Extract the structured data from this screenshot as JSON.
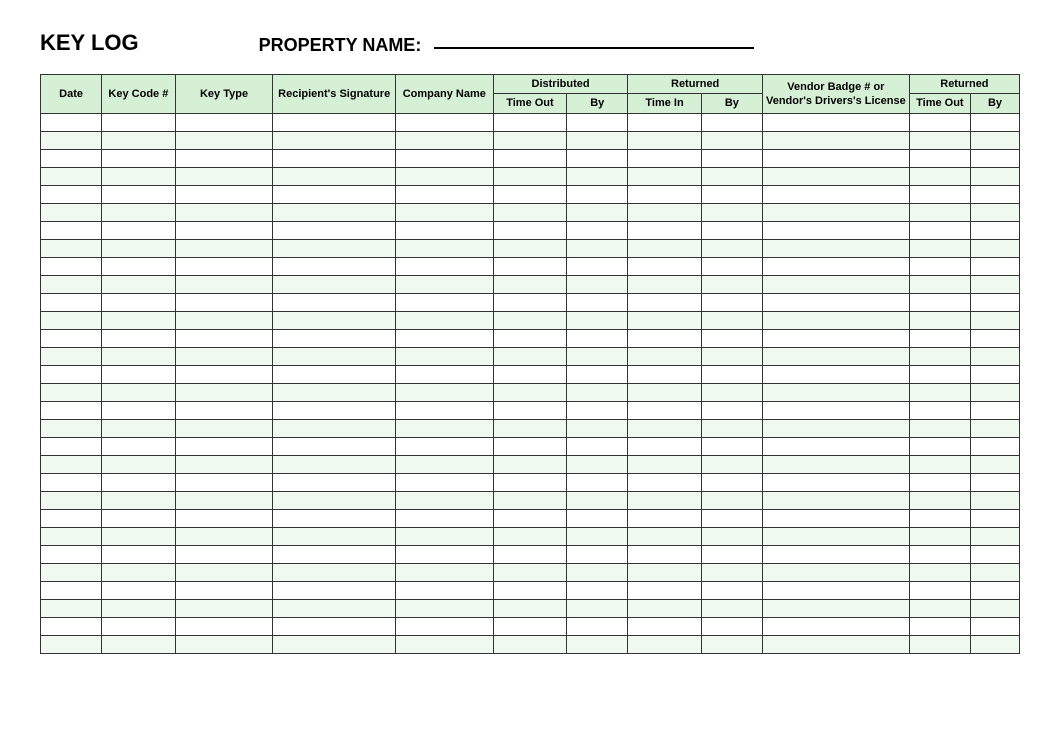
{
  "header": {
    "title": "KEY LOG",
    "property_label": "PROPERTY NAME:"
  },
  "columns": {
    "date": "Date",
    "key_code": "Key Code #",
    "key_type": "Key Type",
    "recipient_signature": "Recipient's Signature",
    "company_name": "Company Name",
    "distributed_label": "Distributed",
    "distributed_time_out": "Time Out",
    "distributed_by": "By",
    "returned_label": "Returned",
    "returned_time_in": "Time In",
    "returned_by": "By",
    "vendor_badge": "Vendor Badge # or Vendor's Drivers's License",
    "returned2_label": "Returned",
    "returned2_time_out": "Time Out",
    "returned2_by": "By"
  },
  "row_count": 30
}
